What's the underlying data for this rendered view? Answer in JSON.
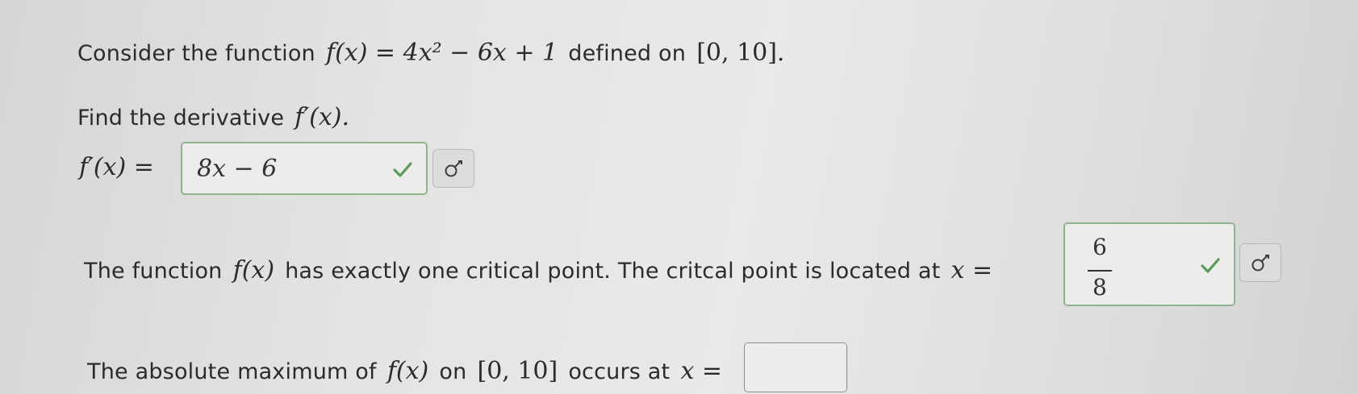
{
  "question": {
    "intro_text": "Consider the function",
    "function_def": "f(x) = 4x² − 6x + 1",
    "defined_on_text": "defined on",
    "interval": "[0, 10].",
    "part1": {
      "prompt_text": "Find the derivative",
      "prompt_math": "f′(x).",
      "lhs": "f′(x) =",
      "answer_value": "8x − 6",
      "status": "correct"
    },
    "part2": {
      "prompt_text_a": "The function",
      "prompt_math_a": "f(x)",
      "prompt_text_b": "has exactly one critical point. The critcal point is located at",
      "lhs": "x =",
      "answer_numerator": "6",
      "answer_denominator": "8",
      "status": "correct"
    },
    "part3": {
      "prompt_text_a": "The absolute maximum of",
      "prompt_math_a": "f(x)",
      "prompt_text_b": "on",
      "prompt_math_b": "[0, 10]",
      "prompt_text_c": "occurs at",
      "lhs": "x =",
      "answer_value": ""
    }
  },
  "colors": {
    "check_green": "#5a9a5a",
    "box_border_correct": "#8fb28f"
  },
  "icons": {
    "check": "check-icon",
    "key": "key-icon"
  }
}
